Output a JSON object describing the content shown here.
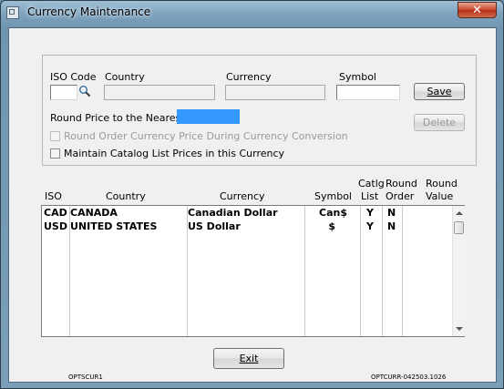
{
  "window": {
    "title": "Currency Maintenance",
    "close_glyph": "✕"
  },
  "form": {
    "iso_code_label": "ISO Code",
    "country_label": "Country",
    "currency_label": "Currency",
    "symbol_label": "Symbol",
    "iso_code_value": "",
    "country_value": "",
    "currency_value": "",
    "symbol_value": "",
    "round_price_label": "Round Price to the Nearest :",
    "round_price_value": "",
    "round_order_label": "Round Order Currency Price During Currency Conversion",
    "maintain_catalog_label": "Maintain Catalog List Prices in this Currency",
    "save_label": "Save",
    "delete_label": "Delete"
  },
  "list": {
    "headers": {
      "iso": "ISO",
      "country": "Country",
      "currency": "Currency",
      "symbol": "Symbol",
      "catlg_list_1": "Catlg",
      "catlg_list_2": "List",
      "round_order_1": "Round",
      "round_order_2": "Order",
      "round_value_1": "Round",
      "round_value_2": "Value"
    },
    "rows": [
      {
        "iso": "CAD",
        "country": "CANADA",
        "currency": "Canadian Dollar",
        "symbol": "Can$",
        "catlg_list": "Y",
        "round_order": "N",
        "round_value": ""
      },
      {
        "iso": "USD",
        "country": "UNITED STATES",
        "currency": "US Dollar",
        "symbol": "$",
        "catlg_list": "Y",
        "round_order": "N",
        "round_value": ""
      }
    ]
  },
  "footer": {
    "exit_label": "Exit",
    "left_code": "OPTSCUR1",
    "right_code": "OPTCURR-042503.1026"
  },
  "colors": {
    "highlight": "#3399ff",
    "title_bar": "#7fa3bd",
    "close_button": "#c9452b"
  }
}
